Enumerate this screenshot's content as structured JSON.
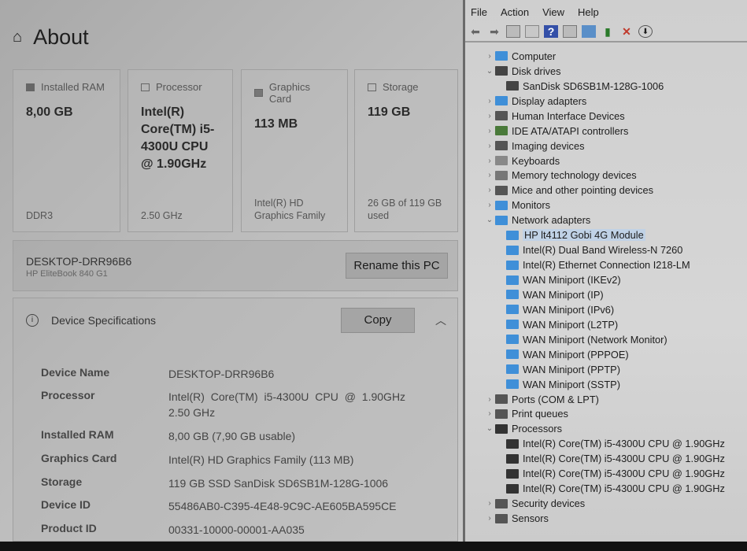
{
  "about": {
    "title": "About",
    "cards": [
      {
        "heading": "Installed RAM",
        "value": "8,00 GB",
        "sub": "DDR3",
        "icon": "ram-icon"
      },
      {
        "heading": "Processor",
        "value": "Intel(R) Core(TM) i5-4300U CPU @ 1.90GHz",
        "sub": "2.50 GHz",
        "icon": "processor-icon"
      },
      {
        "heading": "Graphics Card",
        "value": "113 MB",
        "sub": "Intel(R) HD Graphics Family",
        "icon": "graphics-card-icon"
      },
      {
        "heading": "Storage",
        "value": "119 GB",
        "sub": "26 GB of 119 GB used",
        "icon": "storage-icon"
      }
    ],
    "pc_name": "DESKTOP-DRR96B6",
    "pc_model": "HP EliteBook 840 G1",
    "rename_label": "Rename this PC",
    "specs_title": "Device Specifications",
    "copy_label": "Copy",
    "specs": [
      {
        "k": "Device Name",
        "v": "DESKTOP-DRR96B6"
      },
      {
        "k": "Processor",
        "v": "Intel(R) Core(TM) i5-4300U CPU @ 1.90GHz",
        "v2": "2.50 GHz"
      },
      {
        "k": "Installed RAM",
        "v": "8,00 GB (7,90 GB usable)"
      },
      {
        "k": "Graphics Card",
        "v": "Intel(R) HD Graphics Family (113 MB)"
      },
      {
        "k": "Storage",
        "v": "119 GB SSD SanDisk SD6SB1M-128G-1006"
      },
      {
        "k": "Device ID",
        "v": "55486AB0-C395-4E48-9C9C-AE605BA595CE"
      },
      {
        "k": "Product ID",
        "v": "00331-10000-00001-AA035"
      }
    ]
  },
  "devmgr": {
    "menu": [
      "File",
      "Action",
      "View",
      "Help"
    ],
    "tree": [
      {
        "label": "Computer",
        "level": 0,
        "state": "collapsed",
        "color": "#3f8fd8"
      },
      {
        "label": "Disk drives",
        "level": 0,
        "state": "expanded",
        "color": "#444"
      },
      {
        "label": "SanDisk SD6SB1M-128G-1006",
        "level": 1,
        "color": "#444"
      },
      {
        "label": "Display adapters",
        "level": 0,
        "state": "collapsed",
        "color": "#3f8fd8"
      },
      {
        "label": "Human Interface Devices",
        "level": 0,
        "state": "collapsed",
        "color": "#555"
      },
      {
        "label": "IDE ATA/ATAPI controllers",
        "level": 0,
        "state": "collapsed",
        "color": "#4a7a3a"
      },
      {
        "label": "Imaging devices",
        "level": 0,
        "state": "collapsed",
        "color": "#555"
      },
      {
        "label": "Keyboards",
        "level": 0,
        "state": "collapsed",
        "color": "#888"
      },
      {
        "label": "Memory technology devices",
        "level": 0,
        "state": "collapsed",
        "color": "#777"
      },
      {
        "label": "Mice and other pointing devices",
        "level": 0,
        "state": "collapsed",
        "color": "#555"
      },
      {
        "label": "Monitors",
        "level": 0,
        "state": "collapsed",
        "color": "#3f8fd8"
      },
      {
        "label": "Network adapters",
        "level": 0,
        "state": "expanded",
        "color": "#3f8fd8"
      },
      {
        "label": "HP lt4112 Gobi 4G Module",
        "level": 1,
        "selected": true,
        "color": "#3f8fd8"
      },
      {
        "label": "Intel(R) Dual Band Wireless-N 7260",
        "level": 1,
        "color": "#3f8fd8"
      },
      {
        "label": "Intel(R) Ethernet Connection I218-LM",
        "level": 1,
        "color": "#3f8fd8"
      },
      {
        "label": "WAN Miniport (IKEv2)",
        "level": 1,
        "color": "#3f8fd8"
      },
      {
        "label": "WAN Miniport (IP)",
        "level": 1,
        "color": "#3f8fd8"
      },
      {
        "label": "WAN Miniport (IPv6)",
        "level": 1,
        "color": "#3f8fd8"
      },
      {
        "label": "WAN Miniport (L2TP)",
        "level": 1,
        "color": "#3f8fd8"
      },
      {
        "label": "WAN Miniport (Network Monitor)",
        "level": 1,
        "color": "#3f8fd8"
      },
      {
        "label": "WAN Miniport (PPPOE)",
        "level": 1,
        "color": "#3f8fd8"
      },
      {
        "label": "WAN Miniport (PPTP)",
        "level": 1,
        "color": "#3f8fd8"
      },
      {
        "label": "WAN Miniport (SSTP)",
        "level": 1,
        "color": "#3f8fd8"
      },
      {
        "label": "Ports (COM & LPT)",
        "level": 0,
        "state": "collapsed",
        "color": "#555"
      },
      {
        "label": "Print queues",
        "level": 0,
        "state": "collapsed",
        "color": "#555"
      },
      {
        "label": "Processors",
        "level": 0,
        "state": "expanded",
        "color": "#333"
      },
      {
        "label": "Intel(R) Core(TM) i5-4300U CPU @ 1.90GHz",
        "level": 1,
        "color": "#333"
      },
      {
        "label": "Intel(R) Core(TM) i5-4300U CPU @ 1.90GHz",
        "level": 1,
        "color": "#333"
      },
      {
        "label": "Intel(R) Core(TM) i5-4300U CPU @ 1.90GHz",
        "level": 1,
        "color": "#333"
      },
      {
        "label": "Intel(R) Core(TM) i5-4300U CPU @ 1.90GHz",
        "level": 1,
        "color": "#333"
      },
      {
        "label": "Security devices",
        "level": 0,
        "state": "collapsed",
        "color": "#555"
      },
      {
        "label": "Sensors",
        "level": 0,
        "state": "collapsed",
        "color": "#555"
      }
    ]
  }
}
